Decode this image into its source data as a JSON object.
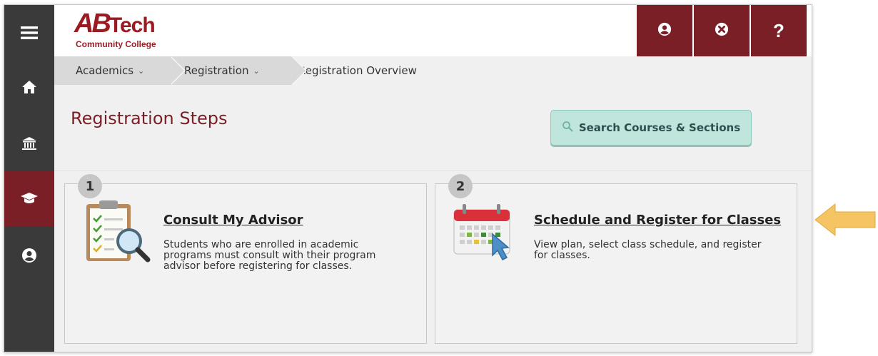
{
  "header": {
    "logo_main": "AB",
    "logo_tech": "Tech",
    "logo_sub": "Community College",
    "buttons": [
      {
        "icon": "user-circle-icon"
      },
      {
        "icon": "close-circle-icon"
      },
      {
        "icon": "help-icon",
        "label": "?"
      }
    ]
  },
  "sidenav": {
    "items": [
      {
        "icon": "menu-icon"
      },
      {
        "icon": "home-icon"
      },
      {
        "icon": "bank-icon"
      },
      {
        "icon": "graduation-cap-icon",
        "active": true
      },
      {
        "icon": "user-circle-icon"
      }
    ]
  },
  "breadcrumb": {
    "items": [
      {
        "label": "Academics",
        "chevron": "⌄"
      },
      {
        "label": "Registration",
        "chevron": "⌄"
      },
      {
        "label": "Registration Overview"
      }
    ]
  },
  "page": {
    "title": "Registration Steps",
    "search_button": "Search Courses & Sections"
  },
  "steps": [
    {
      "number": "1",
      "title": "Consult My Advisor",
      "description": "Students who are enrolled in academic programs must consult with their program advisor before registering for classes.",
      "icon": "clipboard-magnifier-icon"
    },
    {
      "number": "2",
      "title": "Schedule and Register for Classes",
      "description": "View plan, select class schedule, and register for classes.",
      "icon": "calendar-cursor-icon"
    }
  ],
  "colors": {
    "brand": "#7a1f26",
    "sidenav": "#3a3a3a",
    "search_button": "#bfe5dd",
    "pointer_arrow": "#f5c463"
  }
}
